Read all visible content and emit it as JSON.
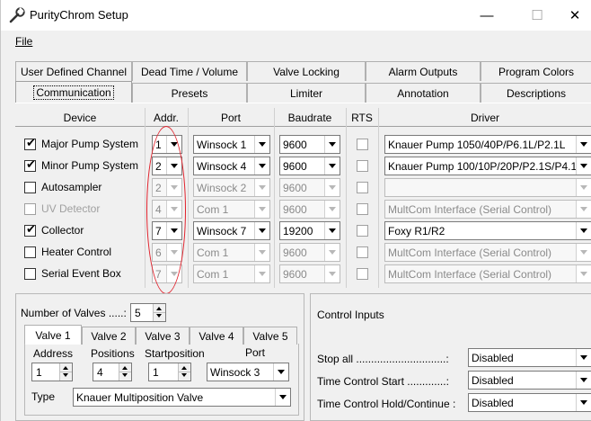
{
  "window": {
    "title": "PurityChrom Setup",
    "controls": {
      "minimize": "—",
      "maximize": "☐",
      "close": "✕"
    }
  },
  "menu": {
    "file_label": "File"
  },
  "tabs": {
    "row1": [
      "User Defined Channel",
      "Dead Time / Volume",
      "Valve Locking",
      "Alarm Outputs",
      "Program Colors"
    ],
    "row2": [
      "Communication",
      "Presets",
      "Limiter",
      "Annotation",
      "Descriptions"
    ],
    "selected": "Communication"
  },
  "table": {
    "headers": [
      "Device",
      "Addr.",
      "Port",
      "Baudrate",
      "RTS",
      "Driver"
    ],
    "rows": [
      {
        "device": "Major Pump System",
        "checked": true,
        "enabled": true,
        "addr": "1",
        "port": "Winsock 1",
        "baud": "9600",
        "rts": false,
        "driver": "Knauer Pump 1050/40P/P6.1L/P2.1L"
      },
      {
        "device": "Minor Pump System",
        "checked": true,
        "enabled": true,
        "addr": "2",
        "port": "Winsock 4",
        "baud": "9600",
        "rts": false,
        "driver": "Knauer Pump 100/10P/20P/P2.1S/P4.1"
      },
      {
        "device": "Autosampler",
        "checked": false,
        "enabled": true,
        "addr": "2",
        "port": "Winsock 2",
        "baud": "9600",
        "rts": false,
        "driver": ""
      },
      {
        "device": "UV Detector",
        "checked": false,
        "enabled": false,
        "addr": "4",
        "port": "Com 1",
        "baud": "9600",
        "rts": false,
        "driver": "MultCom Interface (Serial Control)"
      },
      {
        "device": "Collector",
        "checked": true,
        "enabled": true,
        "addr": "7",
        "port": "Winsock 7",
        "baud": "19200",
        "rts": false,
        "driver": "Foxy R1/R2"
      },
      {
        "device": "Heater Control",
        "checked": false,
        "enabled": true,
        "addr": "6",
        "port": "Com 1",
        "baud": "9600",
        "rts": false,
        "driver": "MultCom Interface (Serial Control)"
      },
      {
        "device": "Serial Event Box",
        "checked": false,
        "enabled": true,
        "addr": "7",
        "port": "Com 1",
        "baud": "9600",
        "rts": false,
        "driver": "MultCom Interface (Serial Control)"
      }
    ]
  },
  "valves": {
    "number_label": "Number of Valves .....:",
    "number_value": "5",
    "tabs": [
      "Valve 1",
      "Valve 2",
      "Valve 3",
      "Valve 4",
      "Valve 5"
    ],
    "selected_tab": "Valve 1",
    "address_label": "Address",
    "address_value": "1",
    "positions_label": "Positions",
    "positions_value": "4",
    "startposition_label": "Startposition",
    "startposition_value": "1",
    "port_label": "Port",
    "port_value": "Winsock 3",
    "type_label": "Type",
    "type_value": "Knauer Multiposition Valve"
  },
  "control_inputs": {
    "title": "Control Inputs",
    "rows": [
      {
        "label": "Stop all ..............................:",
        "value": "Disabled"
      },
      {
        "label": "Time Control Start .............:",
        "value": "Disabled"
      },
      {
        "label": "Time Control Hold/Continue :",
        "value": "Disabled"
      }
    ]
  },
  "colors": {
    "annotation_red": "#e0202a"
  }
}
